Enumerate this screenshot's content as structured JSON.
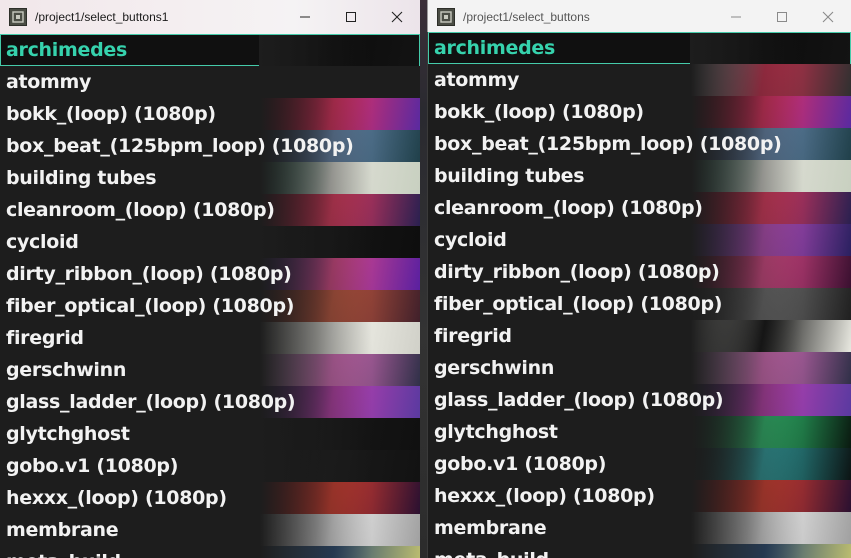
{
  "windows": [
    {
      "title": "/project1/select_buttons1",
      "items": [
        {
          "label": "archimedes",
          "selected": true,
          "thumb": [
            "#111111",
            "#0c0c0c",
            "#131313"
          ]
        },
        {
          "label": "atommy",
          "thumb": [
            "#1d1d1d",
            "#1d1d1d",
            "#1d1d1d"
          ]
        },
        {
          "label": "bokk_(loop) (1080p)",
          "thumb": [
            "#7a1020",
            "#e83060",
            "#5a2aa0"
          ]
        },
        {
          "label": "box_beat_(125bpm_loop) (1080p)",
          "thumb": [
            "#2a3a55",
            "#6a8ab0",
            "#20404a"
          ]
        },
        {
          "label": "building tubes",
          "thumb": [
            "#3a8a70",
            "#e0e0d8",
            "#c8d0c0"
          ]
        },
        {
          "label": "cleanroom_(loop) (1080p)",
          "thumb": [
            "#8a1028",
            "#e83a60",
            "#2a2050"
          ]
        },
        {
          "label": "cycloid",
          "thumb": [
            "#101010",
            "#141414",
            "#0e0e0e"
          ]
        },
        {
          "label": "dirty_ribbon_(loop) (1080p)",
          "thumb": [
            "#3a2a8a",
            "#e04a8a",
            "#5a20a0"
          ]
        },
        {
          "label": "fiber_optical_(loop) (1080p)",
          "thumb": [
            "#6a2a20",
            "#c85a40",
            "#40202a"
          ]
        },
        {
          "label": "firegrid",
          "thumb": [
            "#e8e8e0",
            "#f4f4ec",
            "#d0d0c8"
          ]
        },
        {
          "label": "gerschwinn",
          "thumb": [
            "#c0a0c8",
            "#e070c0",
            "#303048"
          ]
        },
        {
          "label": "glass_ladder_(loop) (1080p)",
          "thumb": [
            "#302060",
            "#c040b0",
            "#5a3aa0"
          ]
        },
        {
          "label": "glytchghost",
          "thumb": [
            "#121212",
            "#161616",
            "#101010"
          ]
        },
        {
          "label": "gobo.v1 (1080p)",
          "thumb": [
            "#121212",
            "#1a1a1a",
            "#121212"
          ]
        },
        {
          "label": "hexxx_(loop) (1080p)",
          "thumb": [
            "#8a1818",
            "#e04030",
            "#2a1030"
          ]
        },
        {
          "label": "membrane",
          "thumb": [
            "#d0d0d0",
            "#f0f0f0",
            "#a0a0a0"
          ]
        },
        {
          "label": "meta_build",
          "thumb": [
            "#406080",
            "#2a4a70",
            "#c0c070"
          ]
        }
      ]
    },
    {
      "title": "/project1/select_buttons",
      "items": [
        {
          "label": "archimedes",
          "selected": true,
          "thumb": [
            "#111111",
            "#0c0c0c",
            "#131313"
          ]
        },
        {
          "label": "atommy",
          "thumb": [
            "#e0e0e0",
            "#d03050",
            "#303030"
          ]
        },
        {
          "label": "bokk_(loop) (1080p)",
          "thumb": [
            "#7a1020",
            "#e83060",
            "#5a2aa0"
          ]
        },
        {
          "label": "box_beat_(125bpm_loop) (1080p)",
          "thumb": [
            "#2a3a55",
            "#6a8ab0",
            "#20404a"
          ]
        },
        {
          "label": "building tubes",
          "thumb": [
            "#3a8a70",
            "#e0e0d8",
            "#c8d0c0"
          ]
        },
        {
          "label": "cleanroom_(loop) (1080p)",
          "thumb": [
            "#8a1028",
            "#e83a60",
            "#2a2050"
          ]
        },
        {
          "label": "cycloid",
          "thumb": [
            "#5a3aa0",
            "#c050c0",
            "#2a2060"
          ]
        },
        {
          "label": "dirty_ribbon_(loop) (1080p)",
          "thumb": [
            "#701030",
            "#e04a8a",
            "#3a1030"
          ]
        },
        {
          "label": "fiber_optical_(loop) (1080p)",
          "thumb": [
            "#303030",
            "#707070",
            "#202020"
          ]
        },
        {
          "label": "firegrid",
          "thumb": [
            "#f0f0e8",
            "#101010",
            "#e8e8e0"
          ]
        },
        {
          "label": "gerschwinn",
          "thumb": [
            "#c0a0c8",
            "#e070c0",
            "#303048"
          ]
        },
        {
          "label": "glass_ladder_(loop) (1080p)",
          "thumb": [
            "#302060",
            "#c040b0",
            "#5a3aa0"
          ]
        },
        {
          "label": "glytchghost",
          "thumb": [
            "#103020",
            "#30c070",
            "#0a1a10"
          ]
        },
        {
          "label": "gobo.v1 (1080p)",
          "thumb": [
            "#101a1a",
            "#30a0a0",
            "#0c1414"
          ]
        },
        {
          "label": "hexxx_(loop) (1080p)",
          "thumb": [
            "#8a1818",
            "#e04030",
            "#2a1030"
          ]
        },
        {
          "label": "membrane",
          "thumb": [
            "#d0d0d0",
            "#f0f0f0",
            "#a0a0a0"
          ]
        },
        {
          "label": "meta_build",
          "thumb": [
            "#406080",
            "#2a4a70",
            "#c0c070"
          ]
        }
      ]
    }
  ]
}
